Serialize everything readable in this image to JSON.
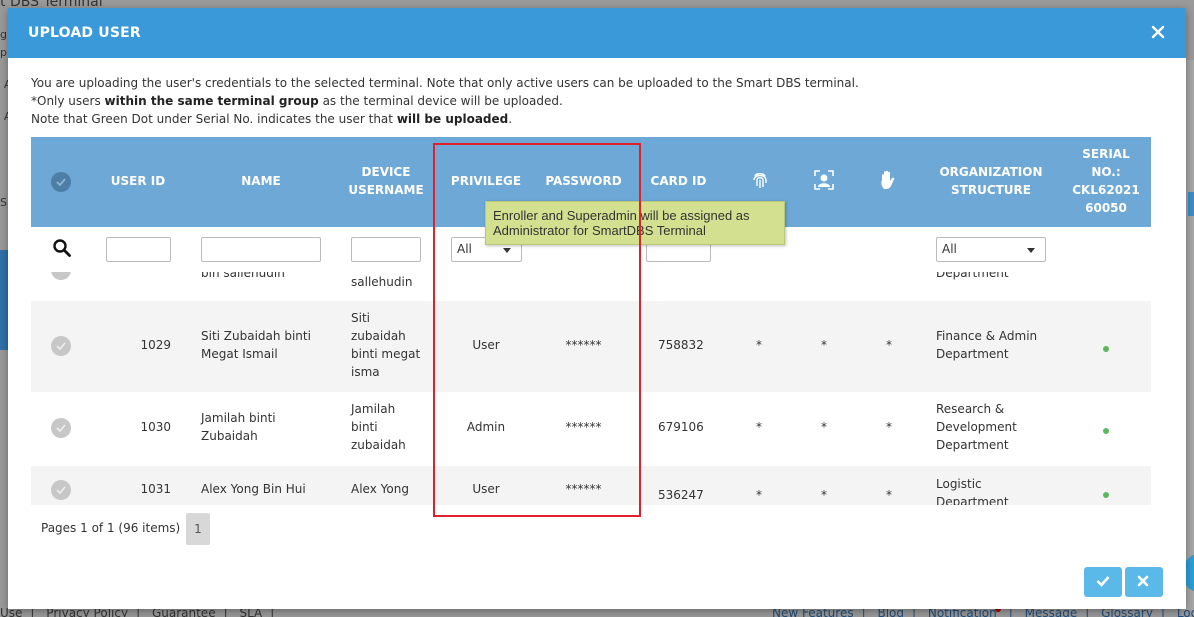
{
  "background": {
    "title": "t DBS Terminal",
    "footer_left": [
      "Use",
      "Privacy Policy",
      "Guarantee",
      "SLA"
    ],
    "footer_right": [
      "New Features",
      "Blog",
      "Notification",
      "Message",
      "Glossary",
      "Log"
    ]
  },
  "modal": {
    "title": "UPLOAD USER",
    "intro_line1": "You are uploading the user's credentials to the selected terminal. Note that only active users can be uploaded to the Smart DBS terminal.",
    "intro_line2_pre": "*Only users ",
    "intro_line2_bold": "within the same terminal group",
    "intro_line2_post": " as the terminal device will be uploaded.",
    "intro_line3_pre": "Note that Green Dot under Serial No. indicates the user that ",
    "intro_line3_bold": "will be uploaded",
    "intro_line3_post": "."
  },
  "table": {
    "headers": {
      "user_id": "USER ID",
      "name": "NAME",
      "device_username_1": "DEVICE",
      "device_username_2": "USERNAME",
      "privilege": "PRIVILEGE",
      "password": "PASSWORD",
      "card_id": "CARD ID",
      "org_1": "ORGANIZATION",
      "org_2": "STRUCTURE",
      "serial_1": "SERIAL",
      "serial_2": "NO.:",
      "serial_3": "CKL62021",
      "serial_4": "60050"
    },
    "filters": {
      "privilege_selected": "All",
      "org_selected": "All"
    },
    "partial_row": {
      "name": "bin sallehudin",
      "device_username": "sallehudin",
      "org": "Department"
    },
    "rows": [
      {
        "user_id": "1029",
        "name_1": "Siti Zubaidah binti",
        "name_2": "Megat Ismail",
        "dev_1": "Siti",
        "dev_2": "zubaidah",
        "dev_3": "binti megat",
        "dev_4": "isma",
        "privilege": "User",
        "password": "******",
        "card_id": "758832",
        "fp": "*",
        "face": "*",
        "palm": "*",
        "org_1": "Finance & Admin",
        "org_2": "Department"
      },
      {
        "user_id": "1030",
        "name_1": "Jamilah binti",
        "name_2": "Zubaidah",
        "dev_1": "Jamilah",
        "dev_2": "binti",
        "dev_3": "zubaidah",
        "privilege": "Admin",
        "password": "******",
        "card_id": "679106",
        "fp": "*",
        "face": "*",
        "palm": "*",
        "org_1": "Research &",
        "org_2": "Development",
        "org_3": "Department"
      },
      {
        "user_id": "1031",
        "name_1": "Alex Yong Bin Hui",
        "dev_1": "Alex Yong",
        "privilege": "User",
        "password": "******",
        "card_id": "536247",
        "fp": "*",
        "face": "*",
        "palm": "*",
        "org_1": "Logistic",
        "org_2": "Department"
      }
    ],
    "pager": {
      "info": "Pages 1 of 1 (96 items)",
      "page": "1"
    }
  },
  "tooltip": {
    "line1": "Enroller and Superadmin will be assigned as",
    "line2": "Administrator for SmartDBS Terminal"
  },
  "icons": {
    "close": "close-icon",
    "search": "search-icon",
    "fingerprint": "fingerprint-icon",
    "face": "face-icon",
    "palm": "palm-icon",
    "confirm": "check-icon",
    "cancel": "x-icon"
  },
  "colors": {
    "header_blue": "#3a9ad9",
    "table_header": "#6ea8d6",
    "green_dot": "#5cb85c",
    "highlight_red": "#e0202a",
    "tooltip_bg": "#d3e090",
    "button_blue": "#5bb9ea"
  }
}
